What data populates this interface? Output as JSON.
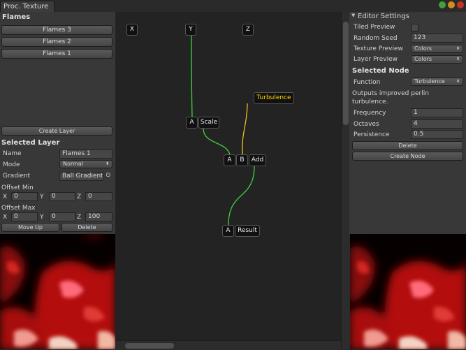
{
  "window": {
    "tab_title": "Proc. Texture"
  },
  "left_panel": {
    "header": "Flames",
    "layers": [
      {
        "label": "Flames 3"
      },
      {
        "label": "Flames 2"
      },
      {
        "label": "Flames 1"
      }
    ],
    "create_layer_label": "Create Layer",
    "selected_layer_header": "Selected Layer",
    "name_label": "Name",
    "name_value": "Flames 1",
    "mode_label": "Mode",
    "mode_value": "Normal",
    "gradient_label": "Gradient",
    "gradient_value": "Ball Gradient",
    "offset_min_label": "Offset Min",
    "offset_min": {
      "x_label": "X",
      "x": "0",
      "y_label": "Y",
      "y": "0",
      "z_label": "Z",
      "z": "0"
    },
    "offset_max_label": "Offset Max",
    "offset_max": {
      "x_label": "X",
      "x": "0",
      "y_label": "Y",
      "y": "0",
      "z_label": "Z",
      "z": "100"
    },
    "move_up_label": "Move Up",
    "delete_label": "Delete"
  },
  "graph": {
    "inputs": {
      "x": "X",
      "y": "Y",
      "z": "Z"
    },
    "turbulence": "Turbulence",
    "scale": {
      "port_a": "A",
      "label": "Scale"
    },
    "add": {
      "port_a": "A",
      "port_b": "B",
      "label": "Add"
    },
    "result": {
      "port_a": "A",
      "label": "Result"
    },
    "wire_color_green": "#3fd23a",
    "wire_color_yellow": "#e6c21e"
  },
  "right_panel": {
    "header": "Editor Settings",
    "tiled_preview_label": "Tiled Preview",
    "random_seed_label": "Random Seed",
    "random_seed_value": "123",
    "texture_preview_label": "Texture Preview",
    "texture_preview_value": "Colors",
    "layer_preview_label": "Layer Preview",
    "layer_preview_value": "Colors",
    "selected_node_header": "Selected Node",
    "function_label": "Function",
    "function_value": "Turbulence",
    "description": "Outputs improved perlin turbulence.",
    "frequency_label": "Frequency",
    "frequency_value": "1",
    "octaves_label": "Octaves",
    "octaves_value": "4",
    "persistence_label": "Persistence",
    "persistence_value": "0.5",
    "delete_label": "Delete",
    "create_node_label": "Create Node"
  },
  "icons": {
    "dropdown": "⬍",
    "gradient_pick": "⊙",
    "foldout": "▼"
  }
}
